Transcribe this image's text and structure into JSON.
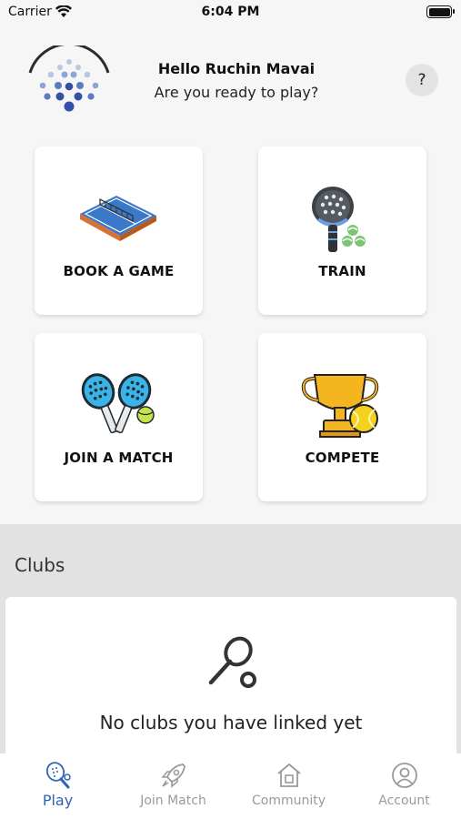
{
  "status_bar": {
    "carrier": "Carrier",
    "time": "6:04 PM"
  },
  "header": {
    "greeting": "Hello Ruchin Mavai",
    "subtitle": "Are you ready to play?",
    "help_label": "?"
  },
  "tiles": [
    {
      "label": "BOOK A GAME",
      "icon": "tennis-court-icon"
    },
    {
      "label": "TRAIN",
      "icon": "padel-racket-balls-icon"
    },
    {
      "label": "JOIN A MATCH",
      "icon": "crossed-rackets-icon"
    },
    {
      "label": "COMPETE",
      "icon": "trophy-icon"
    }
  ],
  "clubs": {
    "title": "Clubs",
    "empty_message": "No clubs you have linked yet"
  },
  "tabbar": {
    "items": [
      {
        "label": "Play",
        "icon": "padel-racket-icon",
        "active": true
      },
      {
        "label": "Join Match",
        "icon": "rocket-icon",
        "active": false
      },
      {
        "label": "Community",
        "icon": "home-icon",
        "active": false
      },
      {
        "label": "Account",
        "icon": "user-circle-icon",
        "active": false
      }
    ]
  },
  "colors": {
    "accent": "#2f63b8",
    "inactive": "#9a9a9a",
    "tile_bg": "#ffffff",
    "page_bg": "#f6f6f6"
  }
}
